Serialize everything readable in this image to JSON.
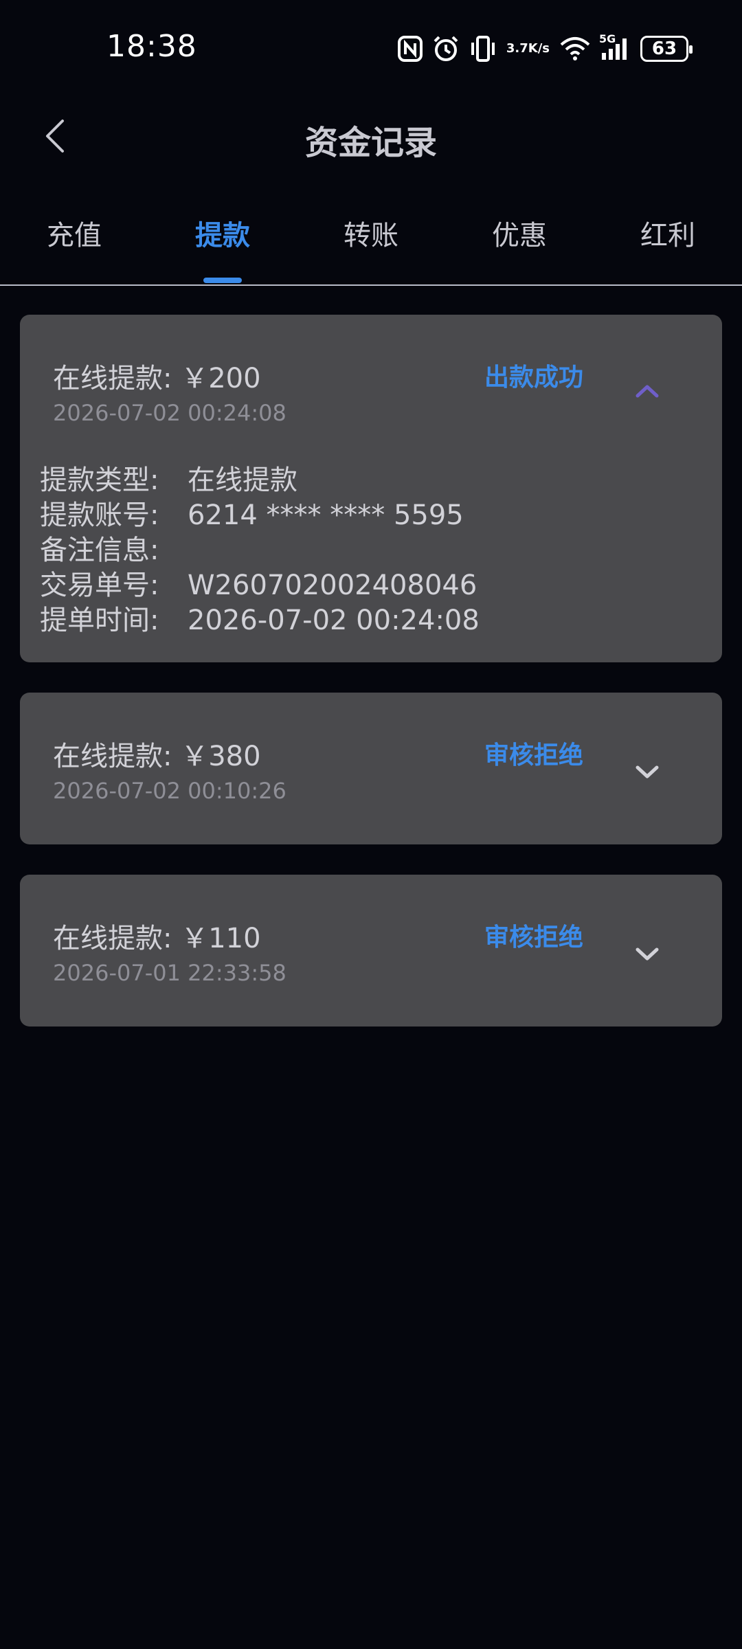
{
  "status_bar": {
    "time": "18:38",
    "network_speed_value": "3.7",
    "network_speed_unit": "K/s",
    "network_type": "5G",
    "battery": "63",
    "icons": [
      "nfc-icon",
      "alarm-icon",
      "vibrate-icon",
      "wifi-icon",
      "signal-icon",
      "battery-icon"
    ]
  },
  "header": {
    "title": "资金记录",
    "back_icon": "chevron-left-icon"
  },
  "tabs": [
    {
      "label": "充值",
      "active": false
    },
    {
      "label": "提款",
      "active": true
    },
    {
      "label": "转账",
      "active": false
    },
    {
      "label": "优惠",
      "active": false
    },
    {
      "label": "红利",
      "active": false
    }
  ],
  "colors": {
    "background": "#05060d",
    "card": "#4a4a4d",
    "accent": "#3b8bea",
    "text": "#c9c9d1",
    "muted": "#8f8f97",
    "chevron_up": "#6f5fc9"
  },
  "records": [
    {
      "title": "在线提款: ￥200",
      "date": "2026-07-02 00:24:08",
      "status": "出款成功",
      "expanded": true,
      "details": [
        {
          "key": "提款类型:",
          "value": "在线提款"
        },
        {
          "key": "提款账号:",
          "value": "6214 **** **** 5595"
        },
        {
          "key": "备注信息:",
          "value": ""
        },
        {
          "key": "交易单号:",
          "value": "W260702002408046"
        },
        {
          "key": "提单时间:",
          "value": "2026-07-02 00:24:08"
        }
      ]
    },
    {
      "title": "在线提款: ￥380",
      "date": "2026-07-02 00:10:26",
      "status": "审核拒绝",
      "expanded": false
    },
    {
      "title": "在线提款: ￥110",
      "date": "2026-07-01 22:33:58",
      "status": "审核拒绝",
      "expanded": false
    }
  ]
}
